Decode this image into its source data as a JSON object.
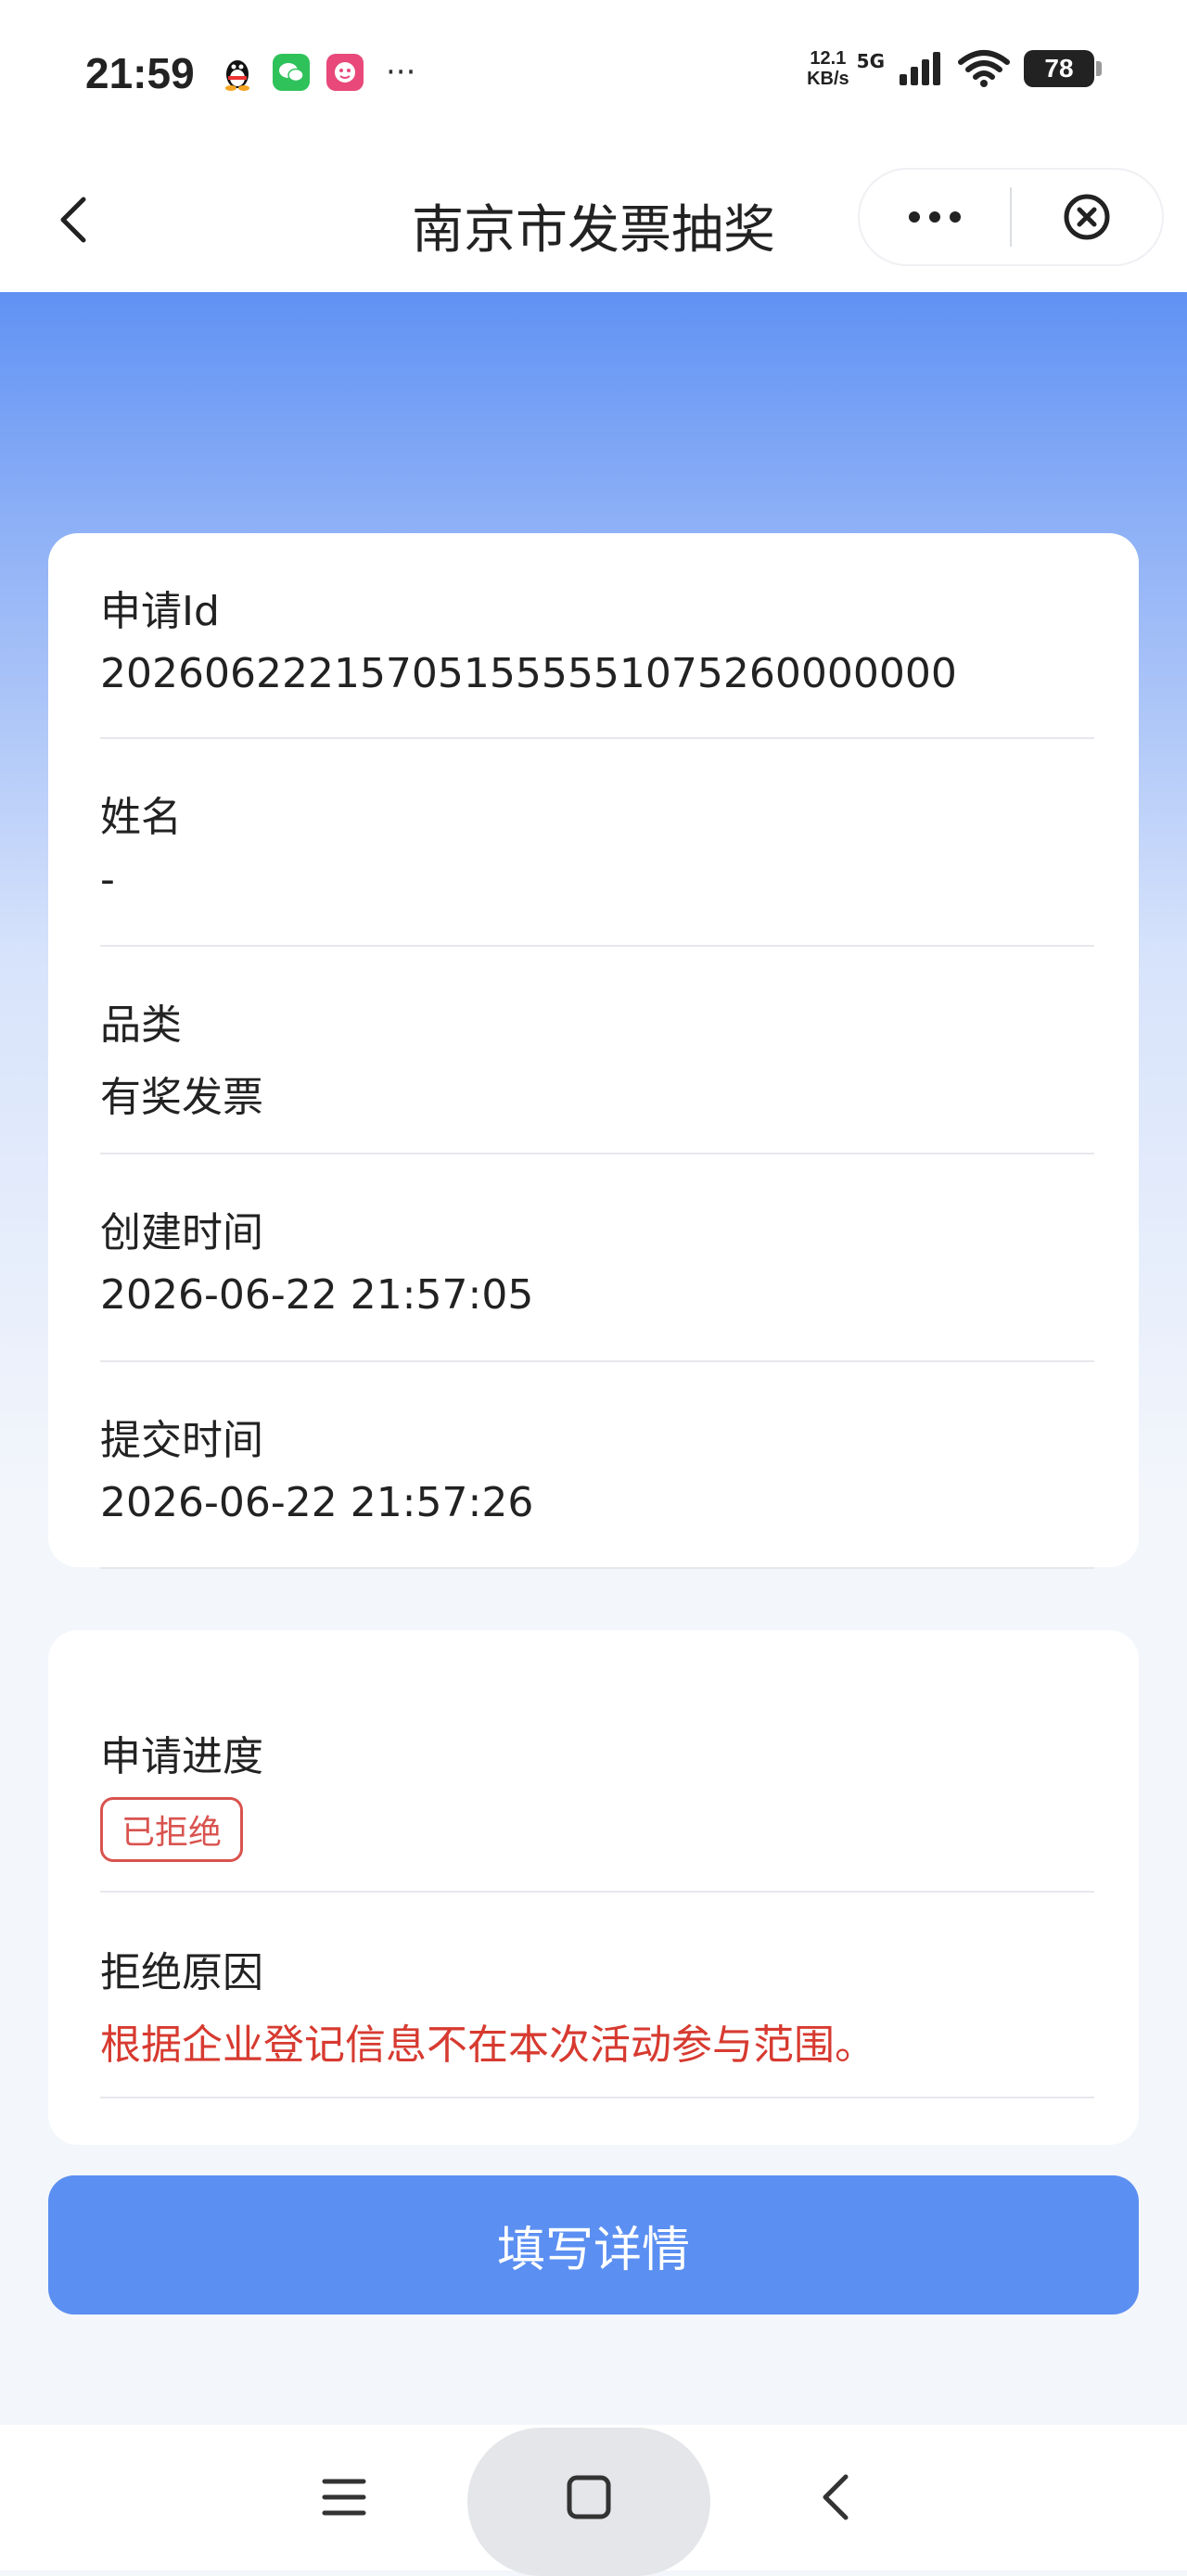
{
  "status_bar": {
    "time": "21:59",
    "more": "···",
    "net_speed_value": "12.1",
    "net_speed_unit": "KB/s",
    "network": "5G",
    "battery": "78"
  },
  "nav": {
    "title": "南京市发票抽奖"
  },
  "info_card": {
    "fields": [
      {
        "label": "申请Id",
        "value": "202606222157051555551075260000000"
      },
      {
        "label": "姓名",
        "value": "-"
      },
      {
        "label": "品类",
        "value": "有奖发票"
      },
      {
        "label": "创建时间",
        "value": "2026-06-22 21:57:05"
      },
      {
        "label": "提交时间",
        "value": "2026-06-22 21:57:26"
      }
    ]
  },
  "status_card": {
    "progress_label": "申请进度",
    "progress_badge": "已拒绝",
    "reason_label": "拒绝原因",
    "reason_value": "根据企业登记信息不在本次活动参与范围。"
  },
  "actions": {
    "submit_label": "填写详情"
  },
  "colors": {
    "accent": "#5b8ff2",
    "reject": "#d73a30"
  }
}
